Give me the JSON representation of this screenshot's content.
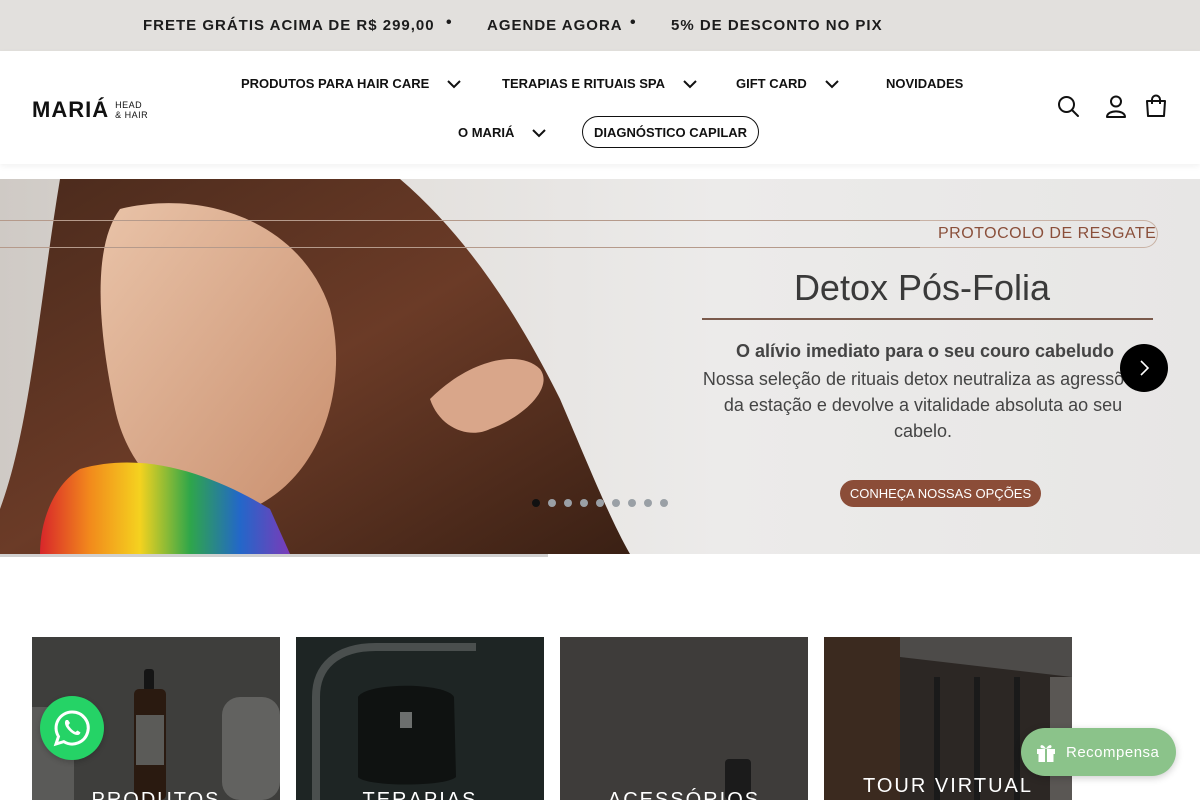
{
  "announcement": {
    "messages": [
      "FRETE GRÁTIS ACIMA DE R$ 299,00",
      "AGENDE AGORA",
      "5% DE DESCONTO NO PIX"
    ],
    "separator": "•"
  },
  "header": {
    "logo_main": "MARIÁ",
    "logo_sub_1": "HEAD",
    "logo_sub_2": "& HAIR",
    "nav": [
      {
        "label": "PRODUTOS PARA HAIR CARE",
        "dropdown": true
      },
      {
        "label": "TERAPIAS E RITUAIS SPA",
        "dropdown": true
      },
      {
        "label": "GIFT CARD",
        "dropdown": true
      },
      {
        "label": "NOVIDADES",
        "dropdown": false
      },
      {
        "label": "O MARIÁ",
        "dropdown": true
      }
    ],
    "diagnostic_button": "DIAGNÓSTICO CAPILAR",
    "icons": [
      "search-icon",
      "account-icon",
      "cart-icon"
    ]
  },
  "hero": {
    "kicker": "PROTOCOLO DE RESGATE",
    "title": "Detox Pós-Folia",
    "lead": "O alívio imediato para o seu couro cabeludo",
    "text": "Nossa seleção de rituais detox neutraliza as agressões da estação e devolve a vitalidade absoluta ao seu cabelo.",
    "cta": "CONHEÇA NOSSAS OPÇÕES",
    "slide_count": 9,
    "active_slide": 1,
    "accent_color": "#8b4d38"
  },
  "categories": [
    {
      "label": "PRODUTOS"
    },
    {
      "label": "TERAPIAS"
    },
    {
      "label": "ACESSÓRIOS"
    },
    {
      "label": "TOUR VIRTUAL"
    }
  ],
  "widgets": {
    "whatsapp_color": "#25d366",
    "reward_label": "Recompensa",
    "reward_color": "#8bc38a"
  }
}
